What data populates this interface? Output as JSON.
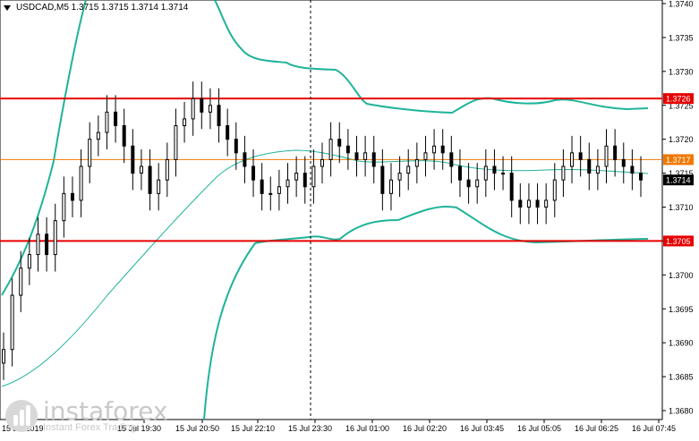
{
  "chart": {
    "symbol_line": "USDCAD,M5  1.3715 1.3715 1.3714 1.3714",
    "y_ticks": [
      "1.3740",
      "1.3735",
      "1.3730",
      "1.3725",
      "1.3720",
      "1.3715",
      "1.3710",
      "1.3705",
      "1.3700",
      "1.3695",
      "1.3690",
      "1.3685",
      "1.3680"
    ],
    "x_ticks": [
      "15 Jul 2019",
      "15 Jul 19:30",
      "15 Jul 20:50",
      "15 Jul 22:10",
      "15 Jul 23:30",
      "16 Jul 01:00",
      "16 Jul 02:20",
      "16 Jul 03:45",
      "16 Jul 05:05",
      "16 Jul 06:25",
      "16 Jul 07:45"
    ],
    "levels": [
      {
        "label": "1.3726",
        "value": 1.3726,
        "color": "#e60000"
      },
      {
        "label": "1.3717",
        "value": 1.3717,
        "color": "#f07800"
      },
      {
        "label": "1.3705",
        "value": 1.3705,
        "color": "#e60000"
      }
    ],
    "current_price_label": "1.3714",
    "colors": {
      "candles": "#000000",
      "bands": "#1fb39a",
      "grid": "#c8c8c8",
      "axis": "#000000"
    }
  },
  "watermark": {
    "name": "instaforex",
    "sub": "Instant Forex Trading"
  },
  "chart_data": {
    "type": "candlestick",
    "ylim": [
      1.368,
      1.374
    ],
    "levels": [
      1.3726,
      1.3717,
      1.3705
    ],
    "closes": [
      1.3689,
      1.3697,
      1.3701,
      1.3703,
      1.3706,
      1.3703,
      1.3708,
      1.3712,
      1.3711,
      1.3716,
      1.372,
      1.3721,
      1.3724,
      1.3722,
      1.3719,
      1.3715,
      1.3716,
      1.3712,
      1.3714,
      1.3717,
      1.3722,
      1.3723,
      1.3726,
      1.3724,
      1.3725,
      1.3722,
      1.372,
      1.3718,
      1.3716,
      1.3714,
      1.3712,
      1.3712,
      1.3713,
      1.3714,
      1.3715,
      1.3713,
      1.3716,
      1.3717,
      1.372,
      1.3719,
      1.3718,
      1.3717,
      1.3718,
      1.3716,
      1.3712,
      1.3714,
      1.3715,
      1.3716,
      1.3717,
      1.3718,
      1.3719,
      1.3718,
      1.3716,
      1.3714,
      1.3713,
      1.3714,
      1.3716,
      1.3715,
      1.3715,
      1.3711,
      1.371,
      1.3711,
      1.371,
      1.3711,
      1.3714,
      1.3716,
      1.3718,
      1.3717,
      1.3715,
      1.3716,
      1.3719,
      1.3717,
      1.3716,
      1.3715,
      1.3714
    ]
  }
}
